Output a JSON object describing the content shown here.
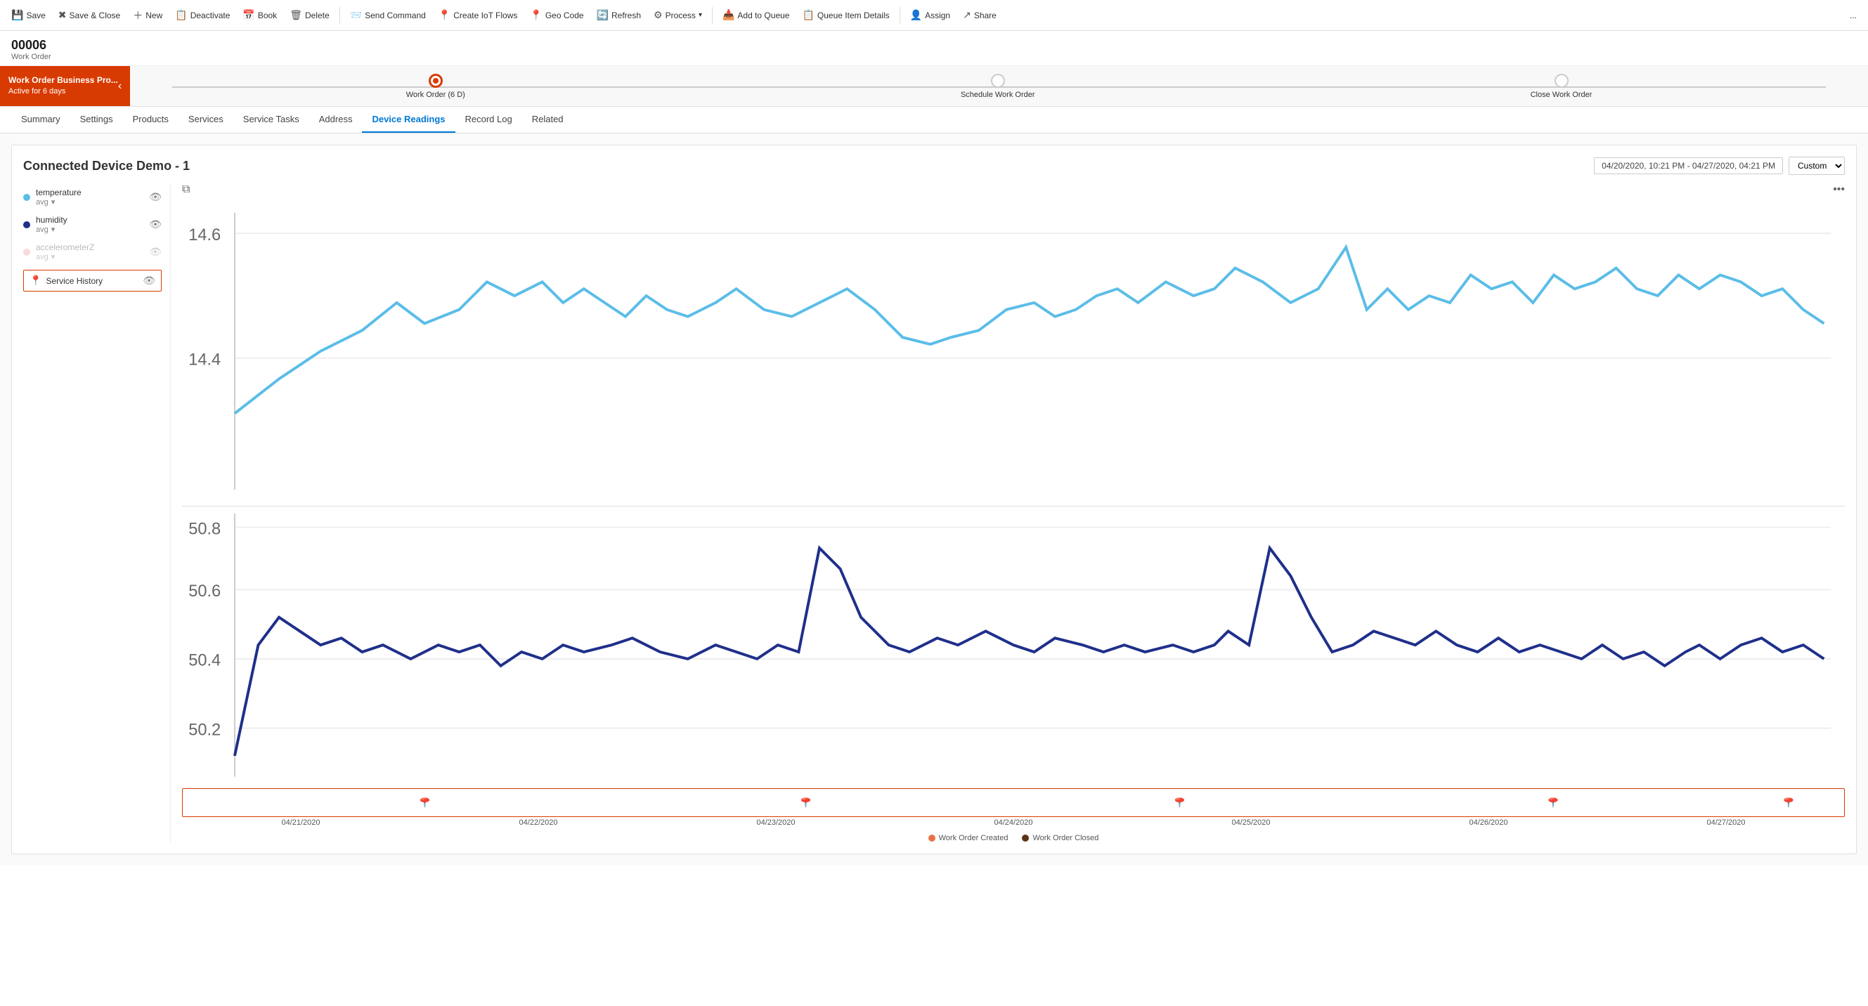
{
  "toolbar": {
    "save_label": "Save",
    "save_close_label": "Save & Close",
    "new_label": "New",
    "deactivate_label": "Deactivate",
    "book_label": "Book",
    "delete_label": "Delete",
    "send_command_label": "Send Command",
    "create_iot_flows_label": "Create IoT Flows",
    "geo_code_label": "Geo Code",
    "refresh_label": "Refresh",
    "process_label": "Process",
    "add_to_queue_label": "Add to Queue",
    "queue_item_details_label": "Queue Item Details",
    "assign_label": "Assign",
    "share_label": "Share",
    "more_label": "..."
  },
  "record": {
    "id": "00006",
    "type": "Work Order"
  },
  "bpf": {
    "active_title": "Work Order Business Pro...",
    "active_subtitle": "Active for 6 days",
    "stage1_label": "Work Order (6 D)",
    "stage2_label": "Schedule Work Order",
    "stage3_label": "Close Work Order"
  },
  "tabs": [
    {
      "id": "summary",
      "label": "Summary",
      "active": false
    },
    {
      "id": "settings",
      "label": "Settings",
      "active": false
    },
    {
      "id": "products",
      "label": "Products",
      "active": false
    },
    {
      "id": "services",
      "label": "Services",
      "active": false
    },
    {
      "id": "service-tasks",
      "label": "Service Tasks",
      "active": false
    },
    {
      "id": "address",
      "label": "Address",
      "active": false
    },
    {
      "id": "device-readings",
      "label": "Device Readings",
      "active": true
    },
    {
      "id": "record-log",
      "label": "Record Log",
      "active": false
    },
    {
      "id": "related",
      "label": "Related",
      "active": false
    }
  ],
  "device_panel": {
    "title": "Connected Device Demo - 1",
    "date_range": "04/20/2020, 10:21 PM - 04/27/2020, 04:21 PM",
    "custom_option": "Custom",
    "legend": [
      {
        "id": "temperature",
        "label": "temperature",
        "sub": "avg",
        "color": "#5bbde8",
        "dim": false
      },
      {
        "id": "humidity",
        "label": "humidity",
        "sub": "avg",
        "color": "#1f2f8a",
        "dim": false
      },
      {
        "id": "accelerometerZ",
        "label": "accelerometerZ",
        "sub": "avg",
        "color": "#f4b8b8",
        "dim": true
      }
    ],
    "service_history_label": "Service History",
    "timeline_dates": [
      "04/21/2020",
      "04/22/2020",
      "04/23/2020",
      "04/24/2020",
      "04/25/2020",
      "04/26/2020",
      "04/27/2020"
    ],
    "bottom_legend": [
      {
        "label": "Work Order Created",
        "color": "#e8734a"
      },
      {
        "label": "Work Order Closed",
        "color": "#5c3317"
      }
    ],
    "y_axis_top": [
      "14.6",
      "14.4"
    ],
    "y_axis_bottom": [
      "50.8",
      "50.6",
      "50.4",
      "50.2"
    ]
  }
}
